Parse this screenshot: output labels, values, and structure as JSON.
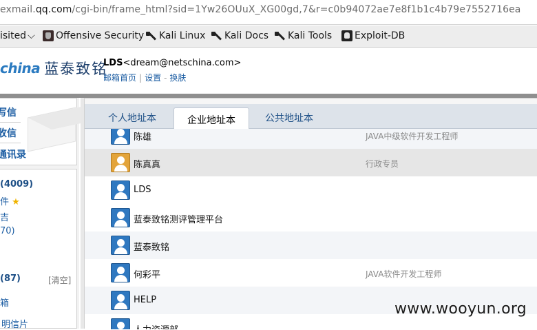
{
  "browser": {
    "url_prefix": "exmail.",
    "url_domain": "qq.com",
    "url_path": "/cgi-bin/frame_html?sid=1Yw26OUuX_XG00gd,7&r=c0b94072ae7e8f1b1c4b79e7552716ea",
    "bookmarks": [
      {
        "label": "isited",
        "icon": "chevron-down-icon"
      },
      {
        "label": "Offensive Security",
        "icon": "offsec-icon"
      },
      {
        "label": "Kali Linux",
        "icon": "kali-dragon-icon"
      },
      {
        "label": "Kali Docs",
        "icon": "kali-dragon-icon"
      },
      {
        "label": "Kali Tools",
        "icon": "kali-dragon-icon"
      },
      {
        "label": "Exploit-DB",
        "icon": "exploit-db-icon"
      }
    ]
  },
  "header": {
    "logo_en": "china",
    "logo_cn": "蓝泰致铭",
    "user_name": "LDS",
    "user_email": "<dream@netschina.com>",
    "links": [
      "邮箱首页",
      "设置",
      "换肤"
    ],
    "link_sep_1": "|",
    "link_sep_2": "-"
  },
  "sidebar": {
    "top_items": [
      "写信",
      "收信",
      "通讯录"
    ],
    "inbox_count": "(4009)",
    "starred_label": "件",
    "item_3": "吉",
    "item_4": "70)",
    "trash_count": "(87)",
    "clear_label": "[清空]",
    "item_6": "箱",
    "item_7": "明信片"
  },
  "tabs": [
    "个人地址本",
    "企业地址本",
    "公共地址本"
  ],
  "active_tab": 1,
  "contacts": [
    {
      "name": "陈雄",
      "title": "JAVA中级软件开发工程师",
      "avatar": "blue"
    },
    {
      "name": "陈真真",
      "title": "行政专员",
      "avatar": "orange"
    },
    {
      "name": "LDS",
      "title": "",
      "avatar": "blue"
    },
    {
      "name": "蓝泰致铭测评管理平台",
      "title": "",
      "avatar": "blue"
    },
    {
      "name": "蓝泰致铭",
      "title": "",
      "avatar": "blue"
    },
    {
      "name": "何彩平",
      "title": "JAVA软件开发工程师",
      "avatar": "blue"
    },
    {
      "name": "HELP",
      "title": "",
      "avatar": "blue"
    },
    {
      "name": "人力资源部",
      "title": "",
      "avatar": "blue"
    }
  ],
  "watermark": "www.wooyun.org",
  "colors": {
    "accent": "#1d5ea3",
    "avatar_blue": "#2f78c0",
    "avatar_orange": "#e3a43a"
  }
}
